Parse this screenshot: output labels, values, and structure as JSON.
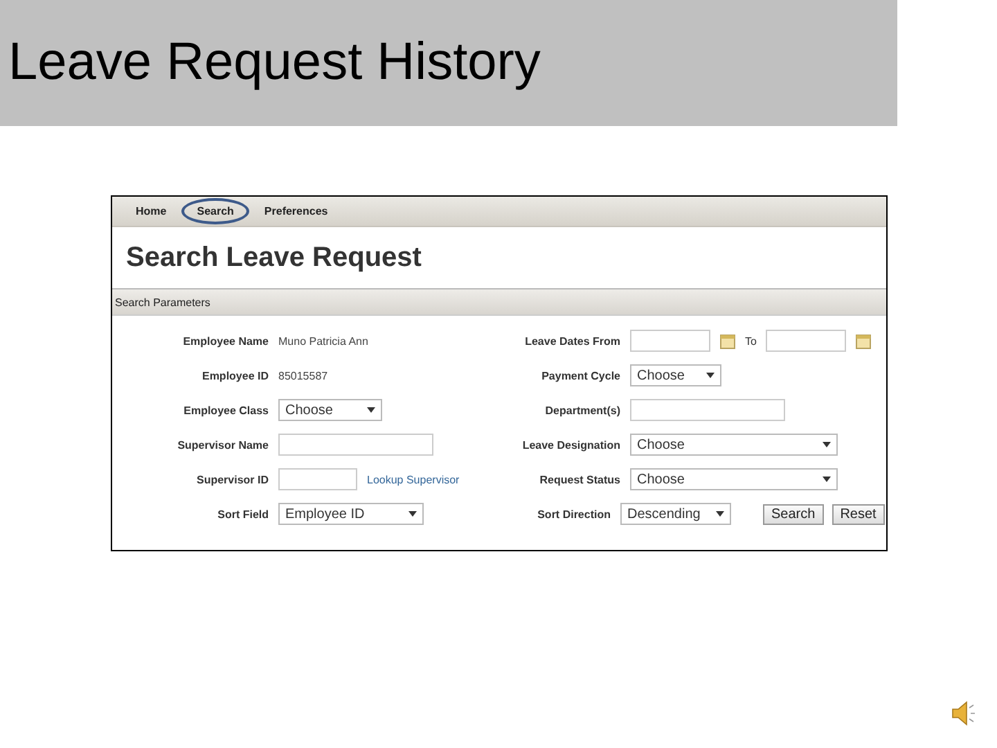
{
  "slide_title": "Leave Request History",
  "app": {
    "nav": [
      {
        "label": "Home",
        "selected": false
      },
      {
        "label": "Search",
        "selected": true
      },
      {
        "label": "Preferences",
        "selected": false
      }
    ],
    "page_title": "Search Leave Request",
    "section_title": "Search Parameters",
    "fields": [
      {
        "label": "Employee Name",
        "kind": "text",
        "value": "Muno Patricia Ann"
      },
      {
        "label": "Leave Dates From",
        "kind": "dates",
        "to_label": "To"
      },
      {
        "label": "Employee ID",
        "kind": "text",
        "value": "85015587"
      },
      {
        "label": "Payment Cycle",
        "kind": "select",
        "value": "Choose"
      },
      {
        "label": "Employee Class",
        "kind": "select",
        "value": "Choose"
      },
      {
        "label": "Department(s)",
        "kind": "input"
      },
      {
        "label": "Supervisor Name",
        "kind": "input"
      },
      {
        "label": "Leave Designation",
        "kind": "select",
        "value": "Choose"
      },
      {
        "label": "Supervisor ID",
        "kind": "lookup",
        "link": "Lookup Supervisor"
      },
      {
        "label": "Request Status",
        "kind": "select",
        "value": "Choose"
      },
      {
        "label": "Sort Field",
        "kind": "select",
        "value": "Employee ID"
      },
      {
        "label": "Sort Direction",
        "kind": "select",
        "value": "Descending"
      }
    ],
    "buttons": [
      "Search",
      "Reset"
    ]
  }
}
